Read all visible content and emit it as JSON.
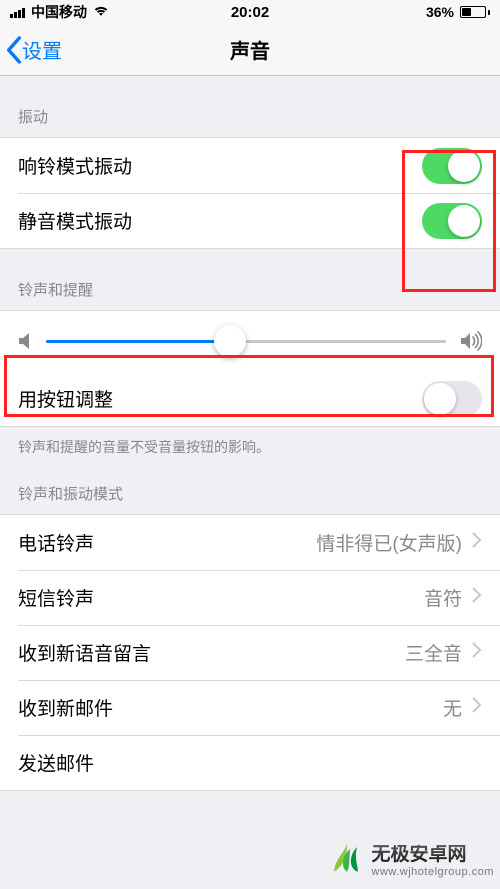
{
  "status_bar": {
    "carrier": "中国移动",
    "time": "20:02",
    "battery_pct": "36%"
  },
  "nav": {
    "back_label": "设置",
    "title": "声音"
  },
  "sections": {
    "vibrate": {
      "header": "振动",
      "ring_vibrate": {
        "label": "响铃模式振动",
        "on": true
      },
      "silent_vibrate": {
        "label": "静音模式振动",
        "on": true
      }
    },
    "ringer": {
      "header": "铃声和提醒",
      "volume_fraction": 0.46,
      "change_with_buttons": {
        "label": "用按钮调整",
        "on": false
      },
      "footer": "铃声和提醒的音量不受音量按钮的影响。"
    },
    "patterns": {
      "header": "铃声和振动模式",
      "ringtone": {
        "label": "电话铃声",
        "value": "情非得已(女声版)"
      },
      "texttone": {
        "label": "短信铃声",
        "value": "音符"
      },
      "voicemail": {
        "label": "收到新语音留言",
        "value": "三全音"
      },
      "newmail": {
        "label": "收到新邮件",
        "value": "无"
      },
      "sendmail": {
        "label": "发送邮件",
        "value": ""
      }
    }
  },
  "watermark": {
    "cn": "无极安卓网",
    "en": "www.wjhotelgroup.com"
  }
}
